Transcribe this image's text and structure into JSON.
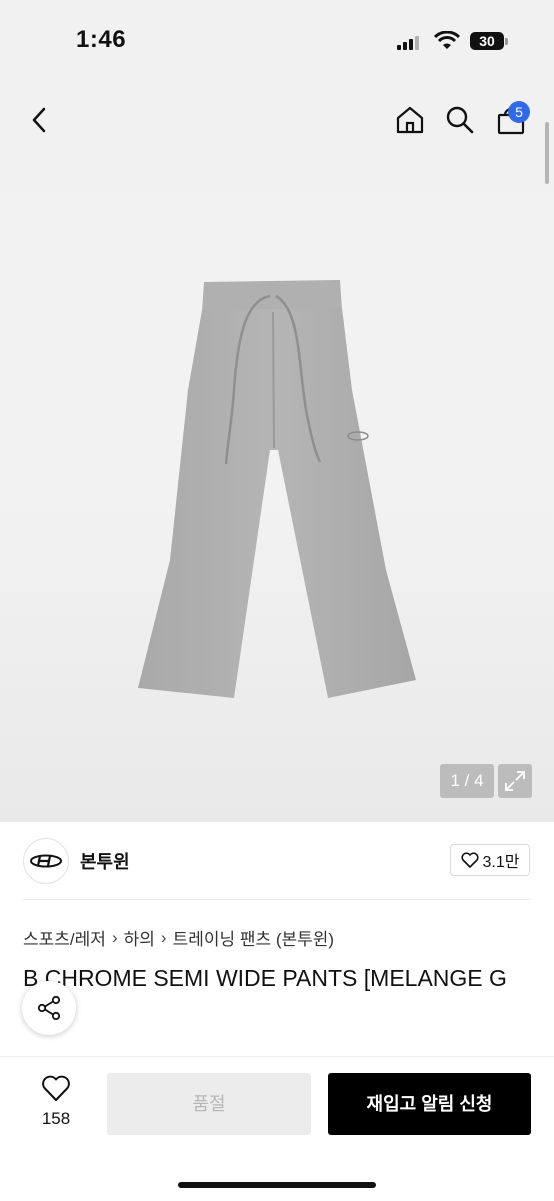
{
  "status_bar": {
    "time": "1:46",
    "battery": "30"
  },
  "header": {
    "cart_count": "5"
  },
  "gallery": {
    "counter": "1 / 4"
  },
  "brand": {
    "name": "본투윈",
    "likes": "3.1만"
  },
  "breadcrumb": [
    "스포츠/레저",
    "하의",
    "트레이닝 팬츠 (본투윈)"
  ],
  "product": {
    "title": "B CHROME SEMI WIDE PANTS [MELANGE G"
  },
  "bottom_bar": {
    "wish_count": "158",
    "soldout_label": "품절",
    "restock_label": "재입고 알림 신청"
  },
  "colors": {
    "badge": "#2f6be8",
    "primary_button": "#000000",
    "disabled_button": "#ececec"
  }
}
